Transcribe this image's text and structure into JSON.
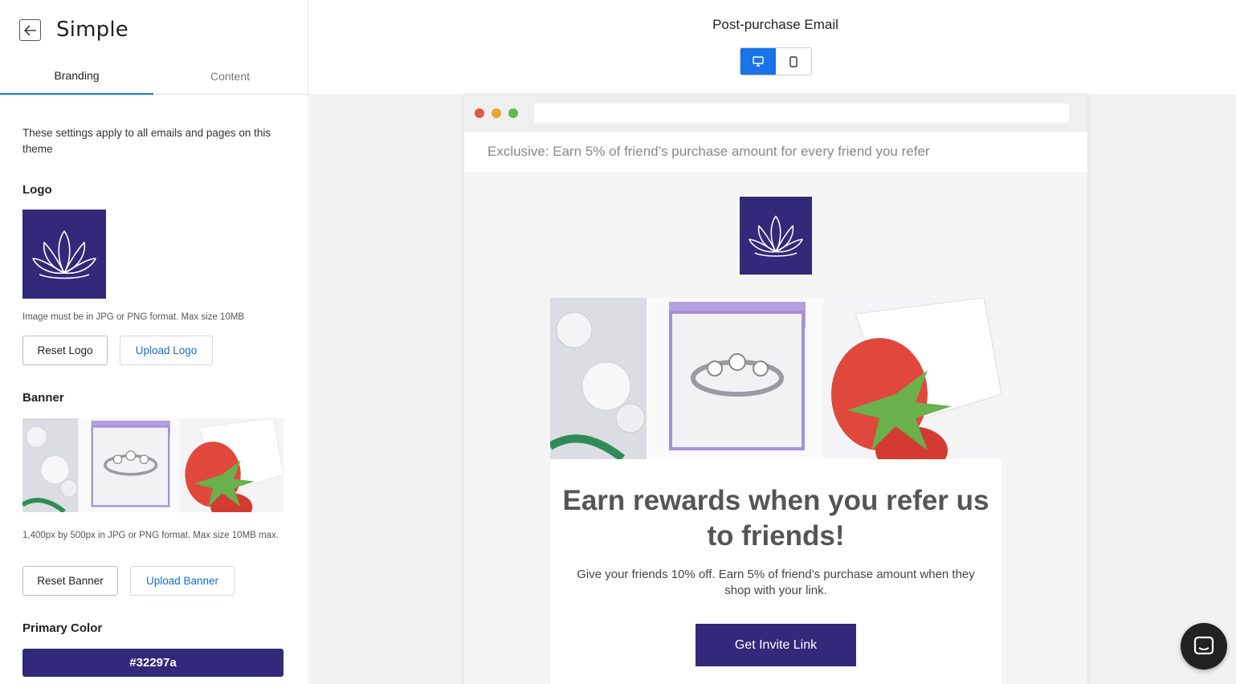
{
  "app": {
    "title": "Simple"
  },
  "tabs": [
    {
      "label": "Branding",
      "active": true
    },
    {
      "label": "Content",
      "active": false
    }
  ],
  "sidebar": {
    "description": "These settings apply to all emails and pages on this theme",
    "logo": {
      "heading": "Logo",
      "hint": "Image must be in JPG or PNG format. Max size 10MB",
      "reset_label": "Reset Logo",
      "upload_label": "Upload Logo"
    },
    "banner": {
      "heading": "Banner",
      "hint": "1,400px by 500px in JPG or PNG format. Max size 10MB max.",
      "reset_label": "Reset Banner",
      "upload_label": "Upload Banner"
    },
    "primary_color": {
      "heading": "Primary Color",
      "value": "#32297a"
    }
  },
  "preview": {
    "title": "Post-purchase Email",
    "device_modes": [
      "desktop-icon",
      "mobile-icon"
    ],
    "active_device": "desktop",
    "preheader": "Exclusive: Earn 5% of friend’s purchase amount for every friend you refer",
    "headline": "Earn rewards when you refer us to friends!",
    "body": "Give your friends 10% off. Earn 5% of friend’s purchase amount when they shop with your link.",
    "cta_label": "Get Invite Link"
  },
  "colors": {
    "brand": "#32297a",
    "accent": "#1a73e8",
    "dot_red": "#e0584a",
    "dot_yellow": "#e6a733",
    "dot_green": "#62b94a"
  }
}
